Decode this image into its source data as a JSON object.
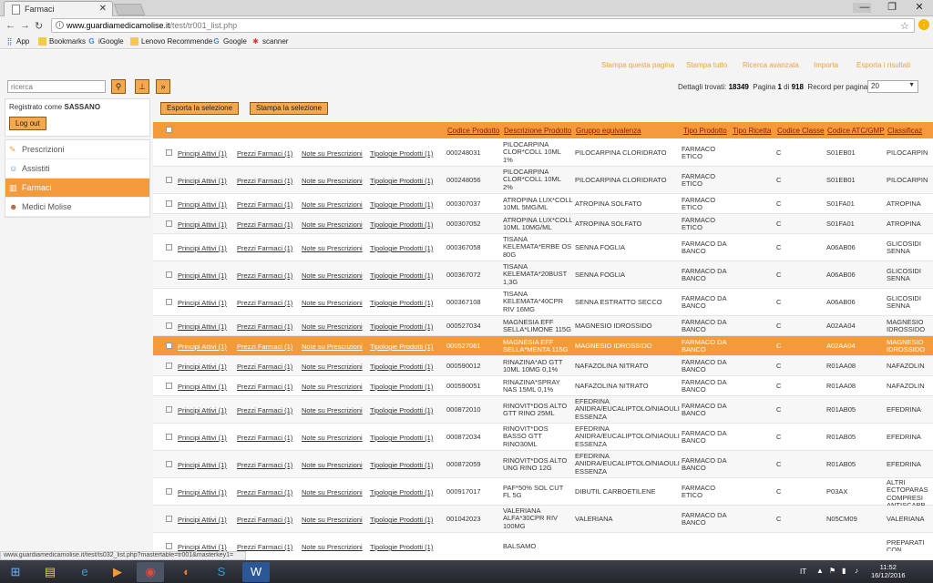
{
  "browser": {
    "tab_title": "Farmaci",
    "url_host": "www.guardiamedicamolise.it",
    "url_path": "/test/tr001_list.php",
    "bookmarks": [
      "App",
      "Bookmarks",
      "iGoogle",
      "Lenovo Recommende",
      "Google",
      "scanner"
    ],
    "status_url": "www.guardiamedicamolise.it/test/ts032_list.php?mastertable=tr001&masterkey1="
  },
  "toplinks": [
    "Stampa questa pagina",
    "Stampa tutto",
    "Ricerca avanzata",
    "Importa",
    "Esporta i risultati"
  ],
  "search": {
    "placeholder": "ricerca"
  },
  "summary": {
    "found_label": "Dettagli trovati:",
    "found": "18349",
    "page_label": "Pagina",
    "page": "1",
    "of_label": "di",
    "pages": "918",
    "perpage_label": "Record per pagina:",
    "perpage": "20"
  },
  "user": {
    "label": "Registrato come",
    "name": "SASSANO",
    "logout": "Log out"
  },
  "menu": [
    {
      "label": "Prescrizioni",
      "icon": "pencil-icon",
      "active": false
    },
    {
      "label": "Assistiti",
      "icon": "people-icon",
      "active": false
    },
    {
      "label": "Farmaci",
      "icon": "chart-icon",
      "active": true
    },
    {
      "label": "Medici Molise",
      "icon": "doctor-icon",
      "active": false
    }
  ],
  "actions": {
    "export": "Esporta la selezione",
    "print": "Stampa la selezione"
  },
  "columns": [
    "Codice Prodotto",
    "Descrizione Prodotto",
    "Gruppo equivalenza",
    "Tipo Prodotto",
    "Tipo Ricetta",
    "Codice Classe",
    "Codice ATC/GMP",
    "Classificaz"
  ],
  "row_links": [
    "Principi Attivi (1)",
    "Prezzi Farmaci (1)",
    "Note su Prescrizioni",
    "Tipologie Prodotti (1)"
  ],
  "rows": [
    {
      "code": "000248031",
      "desc": "PILOCARPINA\nCLOR*COLL 10ML\n1%",
      "group": "PILOCARPINA CLORIDRATO",
      "type": "FARMACO\nETICO",
      "ricetta": "",
      "classe": "C",
      "atc": "S01EB01",
      "classif": "PILOCARPIN"
    },
    {
      "code": "000248056",
      "desc": "PILOCARPINA\nCLOR*COLL 10ML\n2%",
      "group": "PILOCARPINA CLORIDRATO",
      "type": "FARMACO\nETICO",
      "ricetta": "",
      "classe": "C",
      "atc": "S01EB01",
      "classif": "PILOCARPIN"
    },
    {
      "code": "000307037",
      "desc": "ATROPINA LUX*COLL\n10ML 5MG/ML",
      "group": "ATROPINA SOLFATO",
      "type": "FARMACO\nETICO",
      "ricetta": "",
      "classe": "C",
      "atc": "S01FA01",
      "classif": "ATROPINA"
    },
    {
      "code": "000307052",
      "desc": "ATROPINA LUX*COLL\n10ML 10MG/ML",
      "group": "ATROPINA SOLFATO",
      "type": "FARMACO\nETICO",
      "ricetta": "",
      "classe": "C",
      "atc": "S01FA01",
      "classif": "ATROPINA"
    },
    {
      "code": "000367058",
      "desc": "TISANA\nKELEMATA*ERBE OS\n80G",
      "group": "SENNA FOGLIA",
      "type": "FARMACO DA\nBANCO",
      "ricetta": "",
      "classe": "C",
      "atc": "A06AB06",
      "classif": "GLICOSIDI\nSENNA"
    },
    {
      "code": "000367072",
      "desc": "TISANA\nKELEMATA*20BUST\n1,3G",
      "group": "SENNA FOGLIA",
      "type": "FARMACO DA\nBANCO",
      "ricetta": "",
      "classe": "C",
      "atc": "A06AB06",
      "classif": "GLICOSIDI\nSENNA"
    },
    {
      "code": "000367108",
      "desc": "TISANA\nKELEMATA*40CPR\nRIV 16MG",
      "group": "SENNA ESTRATTO SECCO",
      "type": "FARMACO DA\nBANCO",
      "ricetta": "",
      "classe": "C",
      "atc": "A06AB06",
      "classif": "GLICOSIDI\nSENNA"
    },
    {
      "code": "000527034",
      "desc": "MAGNESIA EFF\nSELLA*LIMONE 115G",
      "group": "MAGNESIO IDROSSIDO",
      "type": "FARMACO DA\nBANCO",
      "ricetta": "",
      "classe": "C",
      "atc": "A02AA04",
      "classif": "MAGNESIO\nIDROSSIDO"
    },
    {
      "code": "000527061",
      "desc": "MAGNESIA EFF\nSELLA*MENTA 115G",
      "group": "MAGNESIO IDROSSIDO",
      "type": "FARMACO DA\nBANCO",
      "ricetta": "",
      "classe": "C",
      "atc": "A02AA04",
      "classif": "MAGNESIO\nIDROSSIDO"
    },
    {
      "code": "000590012",
      "desc": "RINAZINA*AD GTT\n10ML 10MG 0,1%",
      "group": "NAFAZOLINA NITRATO",
      "type": "FARMACO DA\nBANCO",
      "ricetta": "",
      "classe": "C",
      "atc": "R01AA08",
      "classif": "NAFAZOLIN"
    },
    {
      "code": "000590051",
      "desc": "RINAZINA*SPRAY\nNAS 15ML 0,1%",
      "group": "NAFAZOLINA NITRATO",
      "type": "FARMACO DA\nBANCO",
      "ricetta": "",
      "classe": "C",
      "atc": "R01AA08",
      "classif": "NAFAZOLIN"
    },
    {
      "code": "000872010",
      "desc": "RINOVIT*DOS ALTO\nGTT RINO 25ML",
      "group": "EFEDRINA\nANIDRA/EUCALIPTOLO/NIAOULI\nESSENZA",
      "type": "FARMACO DA\nBANCO",
      "ricetta": "",
      "classe": "C",
      "atc": "R01AB05",
      "classif": "EFEDRINA"
    },
    {
      "code": "000872034",
      "desc": "RINOVIT*DOS\nBASSO GTT\nRINO30ML",
      "group": "EFEDRINA\nANIDRA/EUCALIPTOLO/NIAOULI\nESSENZA",
      "type": "FARMACO DA\nBANCO",
      "ricetta": "",
      "classe": "C",
      "atc": "R01AB05",
      "classif": "EFEDRINA"
    },
    {
      "code": "000872059",
      "desc": "RINOVIT*DOS ALTO\nUNG RINO 12G",
      "group": "EFEDRINA\nANIDRA/EUCALIPTOLO/NIAOULI\nESSENZA",
      "type": "FARMACO DA\nBANCO",
      "ricetta": "",
      "classe": "C",
      "atc": "R01AB05",
      "classif": "EFEDRINA"
    },
    {
      "code": "000917017",
      "desc": "PAF*50% SOL CUT\nFL 5G",
      "group": "DIBUTIL CARBOETILENE",
      "type": "FARMACO\nETICO",
      "ricetta": "",
      "classe": "C",
      "atc": "P03AX",
      "classif": "ALTRI\nECTOPARAS\nCOMPRESI\nANTISCABB"
    },
    {
      "code": "001042023",
      "desc": "VALERIANA\nALFA*30CPR RIV\n100MG",
      "group": "VALERIANA",
      "type": "FARMACO DA\nBANCO",
      "ricetta": "",
      "classe": "C",
      "atc": "N05CM09",
      "classif": "VALERIANA"
    },
    {
      "code": "",
      "desc": "BALSAMO",
      "group": "",
      "type": "",
      "ricetta": "",
      "classe": "",
      "atc": "",
      "classif": "PREPARATI\nCON"
    }
  ],
  "taskbar": {
    "lang": "IT",
    "time": "11:52",
    "date": "16/12/2016"
  }
}
